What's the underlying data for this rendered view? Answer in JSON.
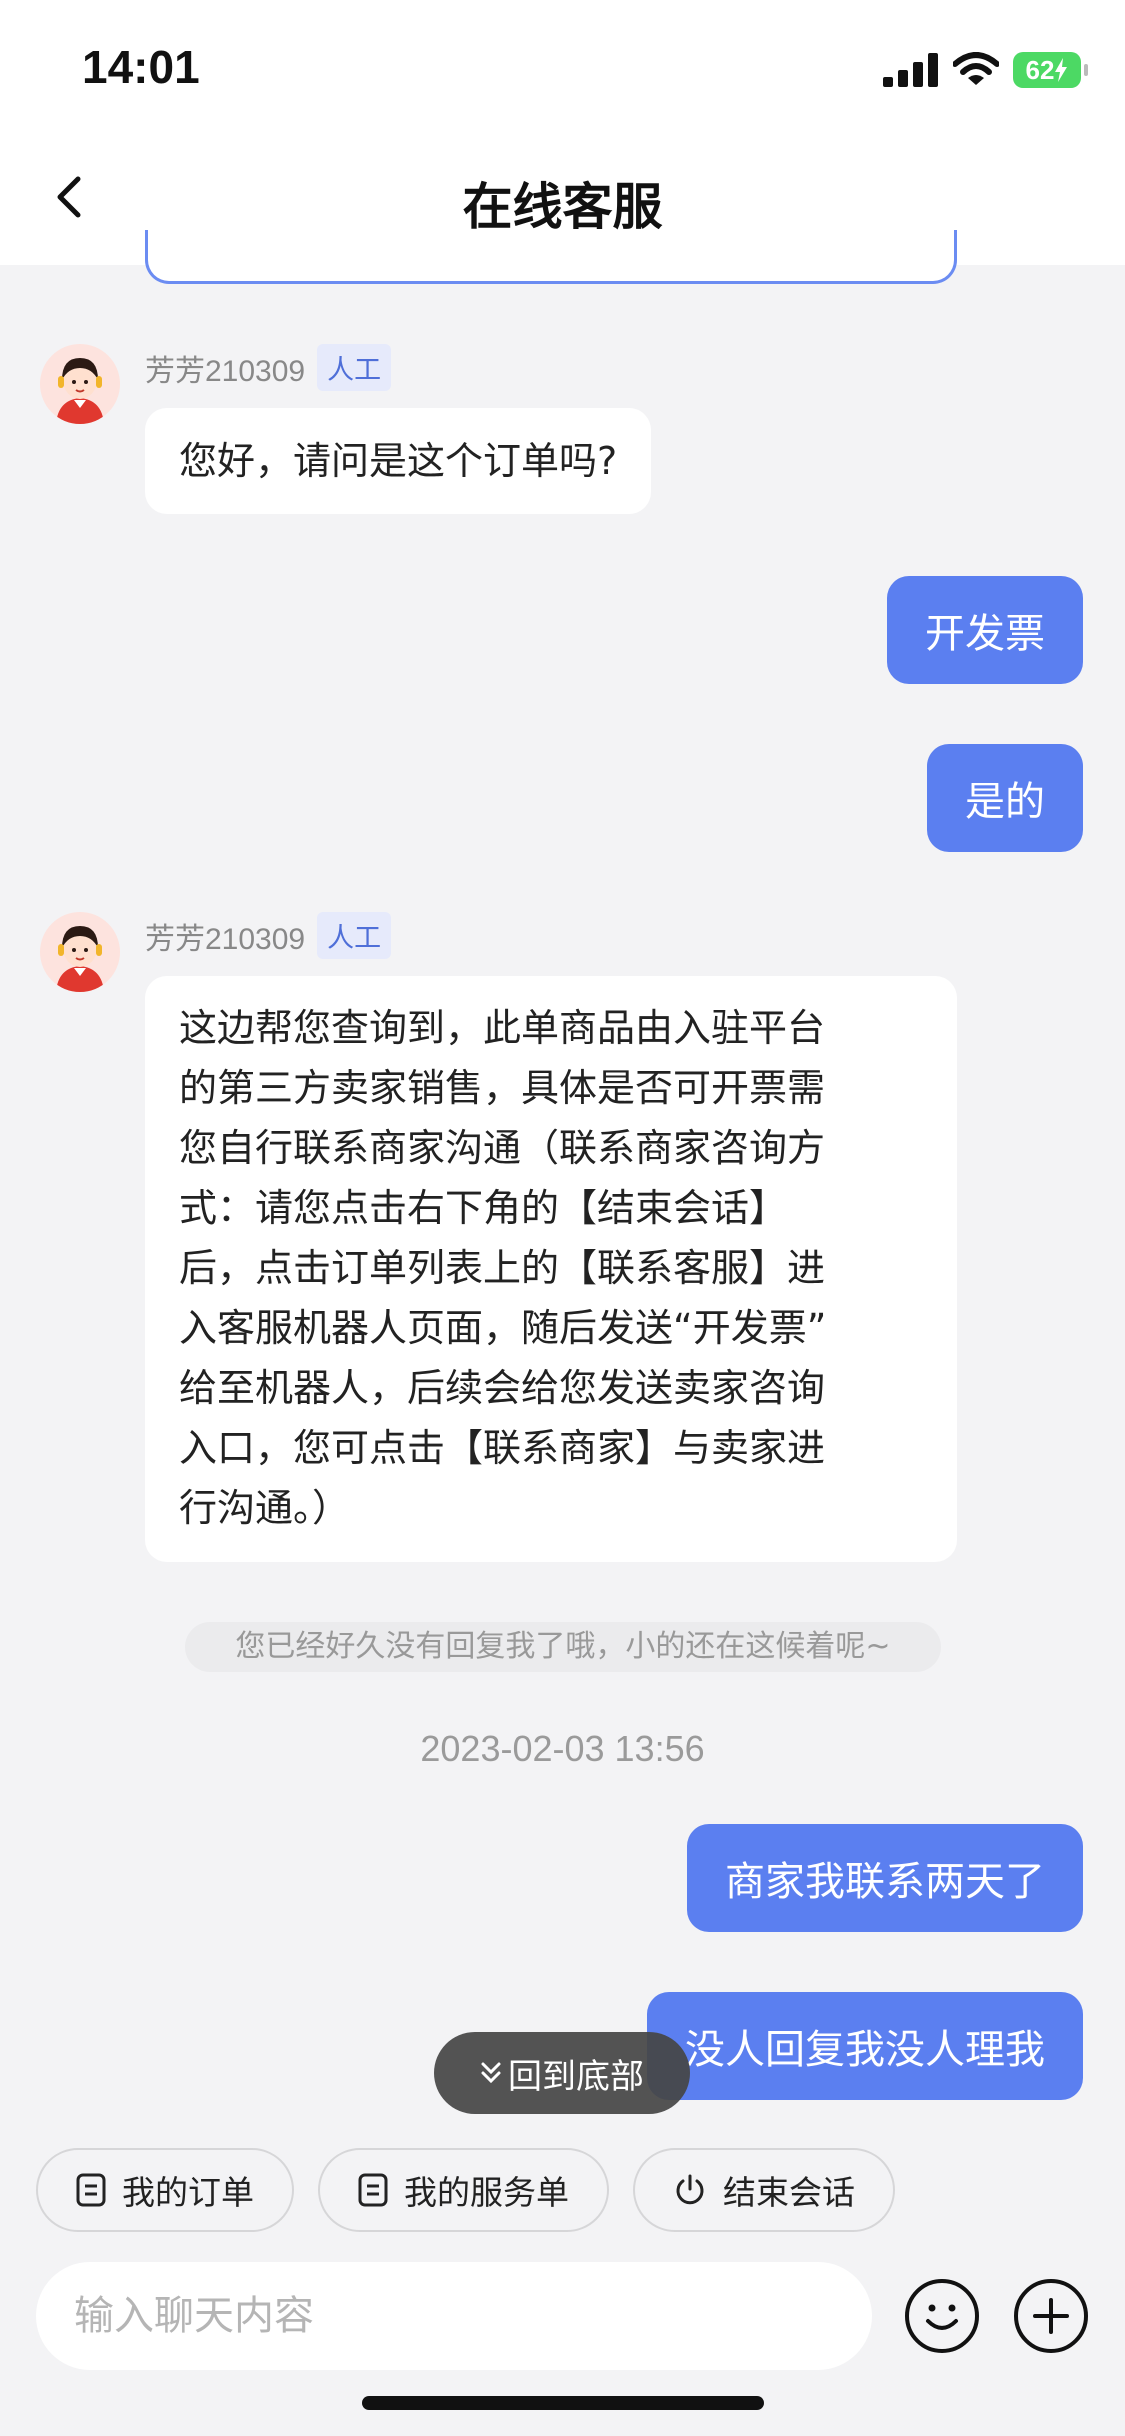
{
  "status_bar": {
    "time": "14:01",
    "battery": "62"
  },
  "header": {
    "title": "在线客服"
  },
  "messages": [
    {
      "agent": "芳芳210309",
      "tag": "人工",
      "text": "您好，请问是这个订单吗?"
    },
    {
      "user": "开发票"
    },
    {
      "user": "是的"
    },
    {
      "agent": "芳芳210309",
      "tag": "人工",
      "lines": [
        "这边帮您查询到，此单商品由入驻平台",
        "的第三方卖家销售，具体是否可开票需",
        "您自行联系商家沟通（联系商家咨询方",
        "式：请您点击右下角的【结束会话】",
        "后，点击订单列表上的【联系客服】进",
        "入客服机器人页面，随后发送“开发票”",
        "给至机器人，后续会给您发送卖家咨询",
        "入口，您可点击【联系商家】与卖家进",
        "行沟通。）"
      ]
    },
    {
      "user": "商家我联系两天了"
    },
    {
      "user": "没人回复我没人理我"
    }
  ],
  "notice": "您已经好久没有回复我了哦，小的还在这候着呢~",
  "timestamp": "2023-02-03 13:56",
  "back_to_bottom": "回到底部",
  "quick_actions": [
    {
      "label": "我的订单",
      "icon": "document-icon"
    },
    {
      "label": "我的服务单",
      "icon": "document-icon"
    },
    {
      "label": "结束会话",
      "icon": "power-icon"
    }
  ],
  "input": {
    "placeholder": "输入聊天内容"
  },
  "colors": {
    "accent": "#5b7ff0",
    "agent_tag_bg": "#e6eafb"
  }
}
